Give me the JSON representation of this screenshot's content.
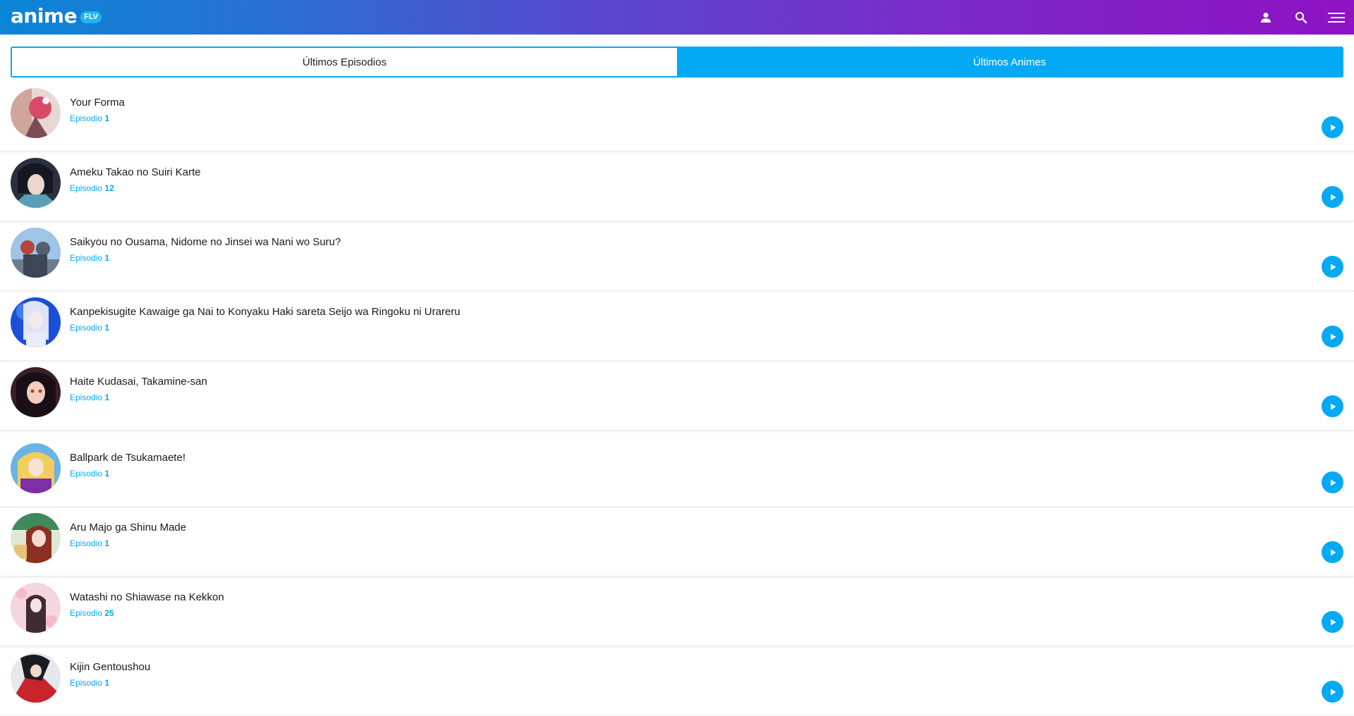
{
  "header": {
    "logo_word": "anime",
    "logo_badge": "FLV",
    "icons": [
      "user-icon",
      "search-icon",
      "menu-icon"
    ],
    "gradient_colors": [
      "#0a86d6",
      "#8f12c4"
    ]
  },
  "tabs": [
    {
      "label": "Últimos Episodios",
      "active": true
    },
    {
      "label": "Últimos Animes",
      "active": false
    }
  ],
  "accent_color": "#03a9f4",
  "episodes": [
    {
      "title": "Your Forma",
      "episode_label": "Episodio",
      "episode_number": "1"
    },
    {
      "title": "Ameku Takao no Suiri Karte",
      "episode_label": "Episodio",
      "episode_number": "12"
    },
    {
      "title": "Saikyou no Ousama, Nidome no Jinsei wa Nani wo Suru?",
      "episode_label": "Episodio",
      "episode_number": "1"
    },
    {
      "title": "Kanpekisugite Kawaige ga Nai to Konyaku Haki sareta Seijo wa Ringoku ni Urareru",
      "episode_label": "Episodio",
      "episode_number": "1"
    },
    {
      "title": "Haite Kudasai, Takamine-san",
      "episode_label": "Episodio",
      "episode_number": "1"
    },
    {
      "title": "Ballpark de Tsukamaete!",
      "episode_label": "Episodio",
      "episode_number": "1"
    },
    {
      "title": "Aru Majo ga Shinu Made",
      "episode_label": "Episodio",
      "episode_number": "1"
    },
    {
      "title": "Watashi no Shiawase na Kekkon",
      "episode_label": "Episodio",
      "episode_number": "25"
    },
    {
      "title": "Kijin Gentoushou",
      "episode_label": "Episodio",
      "episode_number": "1"
    }
  ]
}
